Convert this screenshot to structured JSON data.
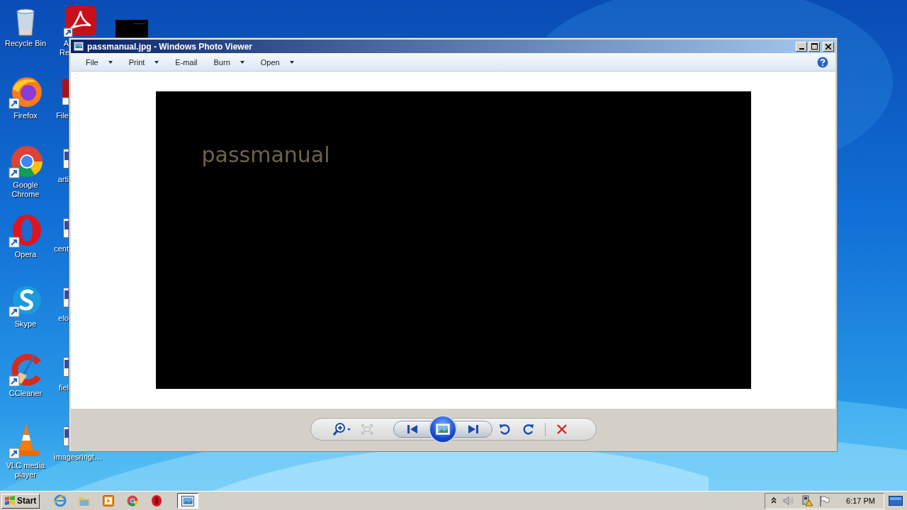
{
  "desktop": {
    "icons": [
      {
        "kind": "bin",
        "label": "Recycle Bin"
      },
      {
        "kind": "fox",
        "label": "Firefox"
      },
      {
        "kind": "chrome",
        "label": "Google Chrome"
      },
      {
        "kind": "ring",
        "label": "Opera"
      },
      {
        "kind": "cloud",
        "label": "Skype"
      },
      {
        "kind": "broom",
        "label": "CCleaner"
      },
      {
        "kind": "cone",
        "label": "VLC media player"
      }
    ],
    "second_column": [
      {
        "kind": "pdf",
        "label": "A Re"
      },
      {
        "kind": "redfile",
        "label": "File"
      },
      {
        "kind": "doc",
        "label": "arti"
      },
      {
        "kind": "doc",
        "label": "cent"
      },
      {
        "kind": "doc",
        "label": "elo"
      },
      {
        "kind": "doc",
        "label": "fiel"
      },
      {
        "kind": "doc",
        "label": "imagesringt…"
      }
    ],
    "thumbnail": {
      "kind": "dark"
    }
  },
  "window": {
    "title": "passmanual.jpg - Windows Photo Viewer",
    "menu": [
      {
        "label": "File",
        "dropdown": true
      },
      {
        "label": "Print",
        "dropdown": true
      },
      {
        "label": "E-mail",
        "dropdown": false
      },
      {
        "label": "Burn",
        "dropdown": true
      },
      {
        "label": "Open",
        "dropdown": true
      }
    ],
    "image": {
      "text": "passmanual"
    },
    "controls": [
      {
        "kind": "zoom",
        "disabled": false
      },
      {
        "kind": "actual-size",
        "disabled": true
      },
      {
        "kind": "previous",
        "disabled": false
      },
      {
        "kind": "slideshow",
        "disabled": false
      },
      {
        "kind": "next",
        "disabled": false
      },
      {
        "kind": "rotate-left",
        "disabled": false
      },
      {
        "kind": "rotate-right",
        "disabled": false
      },
      {
        "kind": "delete",
        "disabled": false
      }
    ]
  },
  "taskbar": {
    "start": "Start",
    "apps": [
      {
        "kind": "ie",
        "selected": false
      },
      {
        "kind": "folder",
        "selected": false
      },
      {
        "kind": "player",
        "selected": false
      },
      {
        "kind": "chrome",
        "selected": false
      },
      {
        "kind": "ring",
        "selected": false
      },
      {
        "kind": "viewer",
        "selected": true
      }
    ],
    "clock": "6:17 PM"
  }
}
